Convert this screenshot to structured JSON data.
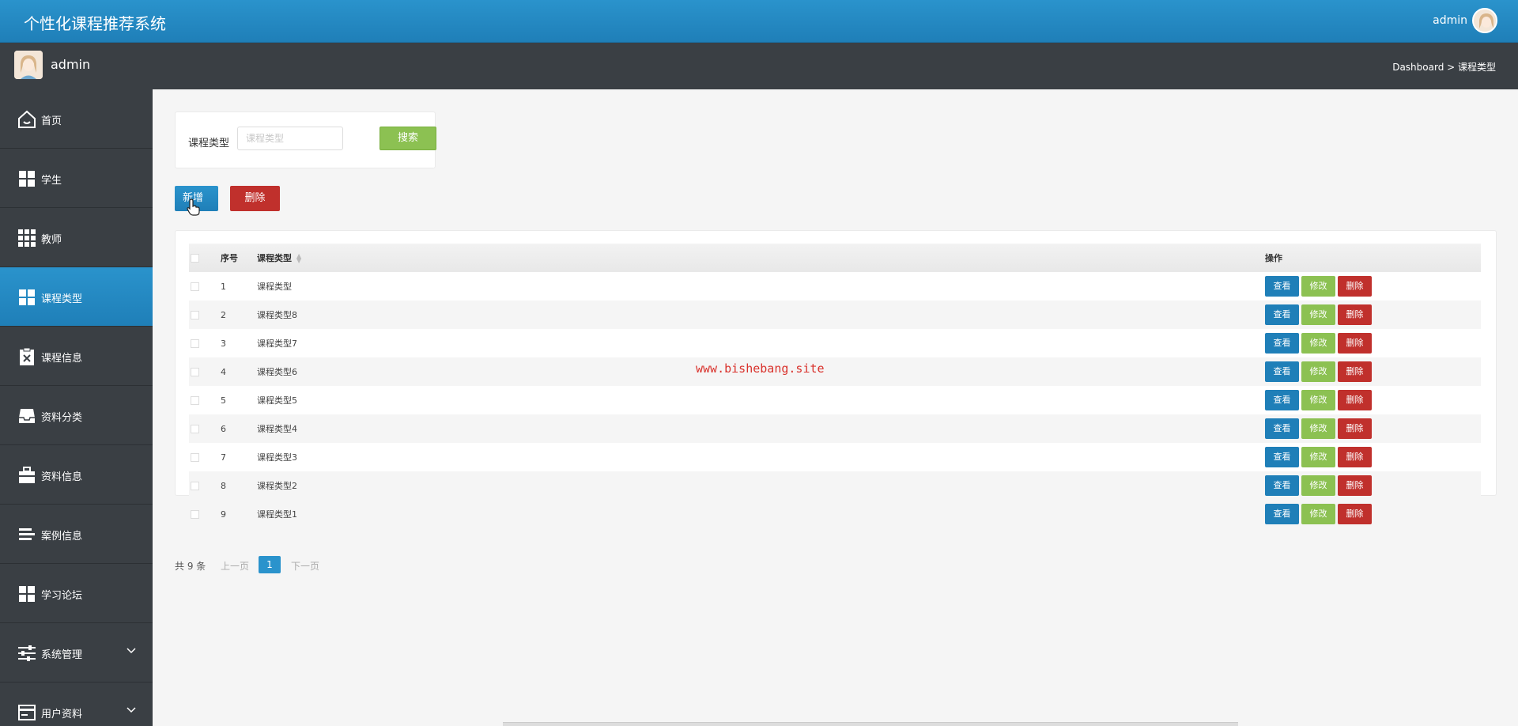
{
  "header": {
    "app_title": "个性化课程推荐系统",
    "user_name": "admin"
  },
  "subbar": {
    "user_name": "admin",
    "breadcrumb": "Dashboard > 课程类型"
  },
  "sidebar": {
    "items": [
      {
        "label": "首页",
        "icon": "home-icon"
      },
      {
        "label": "学生",
        "icon": "grid-icon"
      },
      {
        "label": "教师",
        "icon": "grid9-icon"
      },
      {
        "label": "课程类型",
        "icon": "grid-icon",
        "active": true
      },
      {
        "label": "课程信息",
        "icon": "clipboard-x-icon"
      },
      {
        "label": "资料分类",
        "icon": "inbox-icon"
      },
      {
        "label": "资料信息",
        "icon": "briefcase-icon"
      },
      {
        "label": "案例信息",
        "icon": "list-icon"
      },
      {
        "label": "学习论坛",
        "icon": "grid-icon"
      },
      {
        "label": "系统管理",
        "icon": "sliders-icon",
        "expandable": true
      },
      {
        "label": "用户资料",
        "icon": "card-icon",
        "expandable": true
      }
    ]
  },
  "search": {
    "label": "课程类型",
    "placeholder": "课程类型",
    "value": "",
    "button_label": "搜索"
  },
  "actions": {
    "add_label": "新增",
    "delete_label": "删除"
  },
  "table": {
    "headers": [
      "序号",
      "课程类型",
      "操作"
    ],
    "rows": [
      {
        "idx": "1",
        "type": "课程类型"
      },
      {
        "idx": "2",
        "type": "课程类型8"
      },
      {
        "idx": "3",
        "type": "课程类型7"
      },
      {
        "idx": "4",
        "type": "课程类型6"
      },
      {
        "idx": "5",
        "type": "课程类型5"
      },
      {
        "idx": "6",
        "type": "课程类型4"
      },
      {
        "idx": "7",
        "type": "课程类型3"
      },
      {
        "idx": "8",
        "type": "课程类型2"
      },
      {
        "idx": "9",
        "type": "课程类型1"
      }
    ],
    "row_actions": {
      "view": "查看",
      "edit": "修改",
      "delete": "删除"
    }
  },
  "watermark": "www.bishebang.site",
  "pagination": {
    "total": "共 9 条",
    "prev": "上一页",
    "current": "1",
    "next": "下一页"
  },
  "colors": {
    "primary": "#1f7fb8",
    "success": "#8cc152",
    "danger": "#c0302c",
    "sidebar": "#3a3f44"
  }
}
